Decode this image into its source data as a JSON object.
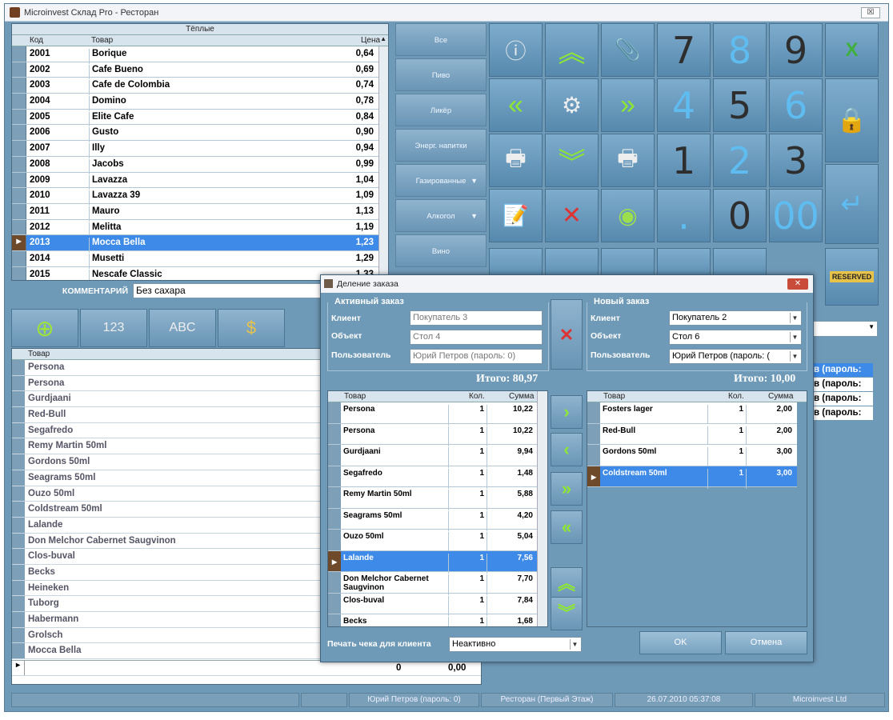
{
  "window": {
    "title": "Microinvest Склад Pro - Ресторан",
    "close": "☒"
  },
  "products": {
    "group": "Тёплые",
    "headers": [
      "Код",
      "Товар",
      "Цена"
    ],
    "rows": [
      [
        "2001",
        "Borique",
        "0,64"
      ],
      [
        "2002",
        "Cafe Bueno",
        "0,69"
      ],
      [
        "2003",
        "Cafe de Colombia",
        "0,74"
      ],
      [
        "2004",
        "Domino",
        "0,78"
      ],
      [
        "2005",
        "Elite Cafe",
        "0,84"
      ],
      [
        "2006",
        "Gusto",
        "0,90"
      ],
      [
        "2007",
        "Illy",
        "0,94"
      ],
      [
        "2008",
        "Jacobs",
        "0,99"
      ],
      [
        "2009",
        "Lavazza",
        "1,04"
      ],
      [
        "2010",
        "Lavazza 39",
        "1,09"
      ],
      [
        "2011",
        "Mauro",
        "1,13"
      ],
      [
        "2012",
        "Melitta",
        "1,19"
      ],
      [
        "2013",
        "Mocca Bella",
        "1,23"
      ],
      [
        "2014",
        "Musetti",
        "1,29"
      ],
      [
        "2015",
        "Nescafe Classic",
        "1,33"
      ]
    ],
    "selected_index": 12
  },
  "categories": [
    {
      "label": "Все"
    },
    {
      "label": "Пиво"
    },
    {
      "label": "Ликёр"
    },
    {
      "label": "Энерг. напитки"
    },
    {
      "label": "Газированные",
      "arrow": "▼"
    },
    {
      "label": "Алкогол",
      "arrow": "▼"
    },
    {
      "label": "Вино"
    }
  ],
  "keypad": {
    "n7": "7",
    "n8": "8",
    "n9": "9",
    "n4": "4",
    "n5": "5",
    "n6": "6",
    "n1": "1",
    "n2": "2",
    "n3": "3",
    "dot": ".",
    "n0": "0",
    "n00": "00"
  },
  "comment": {
    "label": "КОММЕНТАРИЙ",
    "value": "Без сахара"
  },
  "order_list": {
    "header": "Товар",
    "items": [
      "Persona",
      "Persona",
      "Gurdjaani",
      "Red-Bull",
      "Segafredo",
      "Remy Martin 50ml",
      "Gordons 50ml",
      "Seagrams 50ml",
      "Ouzo 50ml",
      "Coldstream 50ml",
      "Lalande",
      "Don Melchor Cabernet Saugvinon",
      "Clos-buval",
      "Becks",
      "Heineken",
      "Tuborg",
      "Habermann",
      "Grolsch",
      "Mocca Bella"
    ],
    "total_qty": "0",
    "total_sum": "0,00"
  },
  "users_bg": [
    "в (пароль:",
    "в (пароль:",
    "в (пароль:",
    "в (пароль:"
  ],
  "status": {
    "user": "Юрий Петров (пароль: 0)",
    "location": "Ресторан (Первый Этаж)",
    "datetime": "26.07.2010 05:37:08",
    "company": "Microinvest Ltd"
  },
  "dialog": {
    "title": "Деление заказа",
    "active": {
      "legend": "Активный заказ",
      "client_label": "Клиент",
      "client": "Покупатель 3",
      "object_label": "Объект",
      "object": "Стол 4",
      "user_label": "Пользователь",
      "user": "Юрий Петров (пароль: 0)",
      "total": "Итого: 80,97",
      "headers": [
        "Товар",
        "Кол.",
        "Сумма"
      ],
      "rows": [
        [
          "Persona",
          "1",
          "10,22"
        ],
        [
          "Persona",
          "1",
          "10,22"
        ],
        [
          "Gurdjaani",
          "1",
          "9,94"
        ],
        [
          "Segafredo",
          "1",
          "1,48"
        ],
        [
          "Remy Martin 50ml",
          "1",
          "5,88"
        ],
        [
          "Seagrams 50ml",
          "1",
          "4,20"
        ],
        [
          "Ouzo 50ml",
          "1",
          "5,04"
        ],
        [
          "Lalande",
          "1",
          "7,56"
        ],
        [
          "Don Melchor Cabernet Saugvinon",
          "1",
          "7,70"
        ],
        [
          "Clos-buval",
          "1",
          "7,84"
        ],
        [
          "Becks",
          "1",
          "1,68"
        ]
      ],
      "selected_index": 7
    },
    "new": {
      "legend": "Новый заказ",
      "client_label": "Клиент",
      "client": "Покупатель 2",
      "object_label": "Объект",
      "object": "Стол 6",
      "user_label": "Пользователь",
      "user": "Юрий Петров (пароль: (",
      "total": "Итого: 10,00",
      "headers": [
        "Товар",
        "Кол.",
        "Сумма"
      ],
      "rows": [
        [
          "Fosters lager",
          "1",
          "2,00"
        ],
        [
          "Red-Bull",
          "1",
          "2,00"
        ],
        [
          "Gordons 50ml",
          "1",
          "3,00"
        ],
        [
          "Coldstream 50ml",
          "1",
          "3,00"
        ]
      ],
      "selected_index": 3
    },
    "print_label": "Печать чека для клиента",
    "print_value": "Неактивно",
    "ok": "OK",
    "cancel": "Отмена"
  }
}
